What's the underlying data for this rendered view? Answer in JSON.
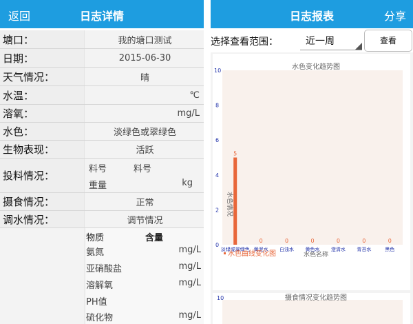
{
  "left": {
    "appbar": {
      "back_label": "返回",
      "title": "日志详情"
    },
    "rows": {
      "pond": {
        "label": "塘口：",
        "value": "我的塘口测试"
      },
      "date": {
        "label": "日期：",
        "value": "2015-06-30"
      },
      "weather": {
        "label": "天气情况：",
        "value": "晴"
      },
      "water_temp": {
        "label": "水温：",
        "unit": "℃"
      },
      "oxygen": {
        "label": "溶氧：",
        "unit": "mg/L"
      },
      "water_color": {
        "label": "水色：",
        "value": "淡绿色或翠绿色"
      },
      "bio": {
        "label": "生物表现：",
        "value": "活跃"
      },
      "feeding": {
        "label": "投料情况：",
        "col1": "料号",
        "col2": "料号",
        "weight_label": "重量",
        "weight_unit": "kg"
      },
      "intake": {
        "label": "摄食情况：",
        "value": "正常"
      },
      "water_adj": {
        "label": "调水情况：",
        "value": "调节情况"
      }
    },
    "substances": {
      "header_name": "物质",
      "header_amount": "含量",
      "items": [
        {
          "name": "氨氮",
          "unit": "mg/L"
        },
        {
          "name": "亚硝酸盐",
          "unit": "mg/L"
        },
        {
          "name": "溶解氧",
          "unit": "mg/L"
        },
        {
          "name": "PH值",
          "unit": ""
        },
        {
          "name": "硫化物",
          "unit": "mg/L"
        }
      ]
    }
  },
  "right": {
    "appbar": {
      "title": "日志报表",
      "share_label": "分享"
    },
    "range_label": "选择查看范围：",
    "range_value": "近一周",
    "view_button": "查看",
    "chart2_title": "摄食情况变化趋势图",
    "chart2_ytick": "10"
  },
  "chart_data": {
    "type": "bar",
    "title": "水色变化趋势图",
    "xlabel": "水色名称",
    "ylabel": "水色情况",
    "legend": "水色曲线变化图",
    "categories": [
      "淡绿或翠绿色",
      "黄泥水",
      "白浊水",
      "黄色水",
      "澄清水",
      "青苔水",
      "黑色"
    ],
    "values": [
      5,
      0,
      0,
      0,
      0,
      0,
      0
    ],
    "ylim": [
      0,
      10
    ],
    "yticks": [
      0,
      2,
      4,
      6,
      8,
      10
    ],
    "colors": {
      "bar": "#e8673a",
      "tick": "#2233aa",
      "plot_bg": "#f9f1ec"
    }
  }
}
